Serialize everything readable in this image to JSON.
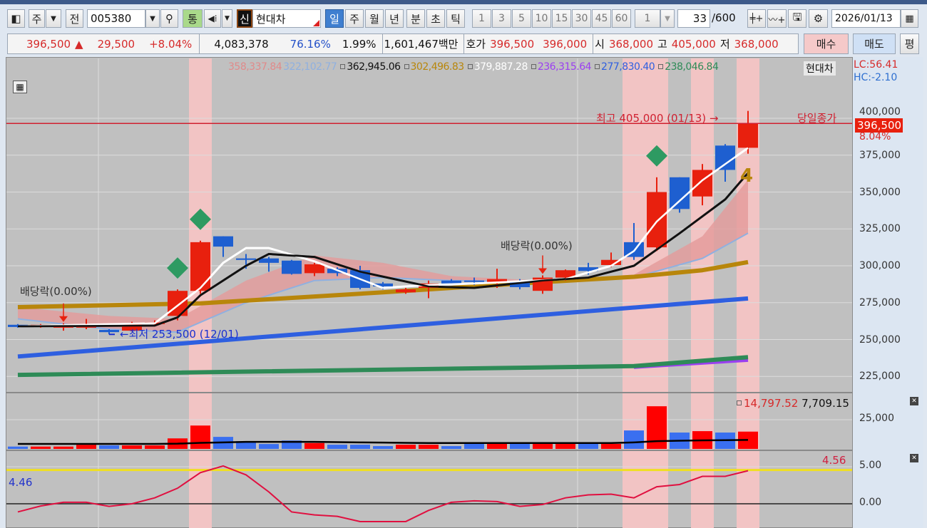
{
  "toolbar": {
    "market": "주",
    "all_label": "전",
    "code": "005380",
    "comm_label": "통",
    "new_label": "신",
    "stock_name": "현대차",
    "periods": [
      "일",
      "주",
      "월",
      "년",
      "분",
      "초",
      "틱"
    ],
    "selected_period": "일",
    "intervals": [
      "1",
      "3",
      "5",
      "10",
      "15",
      "30",
      "45",
      "60"
    ],
    "multiplier": "1",
    "count": "33",
    "count_total": "/600",
    "date": "2026/01/13"
  },
  "quote": {
    "price": "396,500",
    "arrow": "▲",
    "change": "29,500",
    "change_pct": "+8.04%",
    "volume": "4,083,378",
    "vol_ratio": "76.16%",
    "turnover": "1.99%",
    "amount": "1,601,467백만",
    "bid_label": "호가",
    "ask": "396,500",
    "bid": "396,000",
    "open_label": "시",
    "open": "368,000",
    "high_label": "고",
    "high": "405,000",
    "low_label": "저",
    "low": "368,000",
    "buy_label": "매수",
    "sell_label": "매도",
    "avg_label": "평"
  },
  "legend": [
    {
      "text": "358,337.84",
      "color": "#e08a8a",
      "box": false
    },
    {
      "text": "322,102.77",
      "color": "#8fb0e0",
      "box": false
    },
    {
      "text": "362,945.06",
      "color": "#111111",
      "box": true
    },
    {
      "text": "302,496.83",
      "color": "#b8860b",
      "box": true
    },
    {
      "text": "379,887.28",
      "color": "#ffffff",
      "box": true
    },
    {
      "text": "236,315.64",
      "color": "#9a3ff0",
      "box": true
    },
    {
      "text": "277,830.40",
      "color": "#2e5fe0",
      "box": true
    },
    {
      "text": "238,046.84",
      "color": "#2e8b57",
      "box": true
    }
  ],
  "legend_name": "현대차",
  "axis": {
    "lc": "LC:56.41",
    "hc": "HC:-2.10",
    "price_ticks": [
      "400,000",
      "375,000",
      "350,000",
      "325,000",
      "300,000",
      "275,000",
      "250,000",
      "225,000"
    ],
    "current_price": "396,500",
    "current_pct": "8.04%",
    "volume_tick": "25,000",
    "indicator_ticks": [
      "5.00",
      "0.00"
    ]
  },
  "annotations": {
    "dividend1": "배당락(0.00%)",
    "dividend2": "배당락(0.00%)",
    "high": "최고 405,000 (01/13) →",
    "low": "←최저 253,500 (12/01)",
    "close_label": "당일종가",
    "signal_glyph": "4"
  },
  "volume_legend": {
    "value": "14,797.52",
    "ma": "7,709.15"
  },
  "indicator_legend": {
    "left": "4.46",
    "right": "4.56"
  },
  "colors": {
    "up": "#e8200e",
    "down": "#1e5fd0",
    "highlight": "#f2c4c4",
    "signal": "#2e9a62"
  },
  "chart_data": {
    "type": "candlestick",
    "price_range": [
      215000,
      425000
    ],
    "candles_ohlc": [
      [
        260000,
        260500,
        258000,
        258500
      ],
      [
        258500,
        260500,
        258000,
        260000
      ],
      [
        258500,
        261000,
        256000,
        259000
      ],
      [
        258500,
        264000,
        257000,
        259000
      ],
      [
        256500,
        257000,
        253500,
        255000
      ],
      [
        256000,
        262000,
        255500,
        261000
      ],
      [
        260500,
        263000,
        259000,
        261500
      ],
      [
        266000,
        284000,
        263000,
        283000
      ],
      [
        283000,
        317000,
        281000,
        316000
      ],
      [
        320000,
        320000,
        306000,
        313000
      ],
      [
        305000,
        308000,
        298000,
        304000
      ],
      [
        305000,
        306000,
        296000,
        302000
      ],
      [
        303500,
        304000,
        294000,
        294500
      ],
      [
        295000,
        302000,
        293000,
        301000
      ],
      [
        298000,
        299000,
        293000,
        295000
      ],
      [
        297000,
        300000,
        284000,
        285000
      ],
      [
        288000,
        289000,
        284000,
        286000
      ],
      [
        282000,
        285000,
        281000,
        284000
      ],
      [
        285000,
        290000,
        278000,
        288000
      ],
      [
        290000,
        291000,
        287000,
        288000
      ],
      [
        290000,
        292000,
        287000,
        289500
      ],
      [
        289000,
        298000,
        285000,
        291000
      ],
      [
        289000,
        291000,
        284000,
        285500
      ],
      [
        283000,
        293500,
        281000,
        292000
      ],
      [
        292000,
        297500,
        290000,
        297000
      ],
      [
        299000,
        302000,
        294000,
        296500
      ],
      [
        300500,
        309000,
        299000,
        304000
      ],
      [
        316000,
        329000,
        304000,
        306000
      ],
      [
        312500,
        360000,
        310000,
        350000
      ],
      [
        360000,
        360000,
        336000,
        338500
      ],
      [
        347000,
        369000,
        341000,
        365000
      ],
      [
        381500,
        382500,
        357000,
        365000
      ],
      [
        380000,
        405000,
        376000,
        396500
      ]
    ],
    "highlighted_candles": [
      8,
      27,
      28,
      30,
      32
    ],
    "signal_diamonds": [
      7,
      8,
      28
    ],
    "dividend_markers": [
      2,
      23
    ],
    "ma_lines": [
      {
        "color": "#ffffff",
        "points": [
          [
            0,
            259000
          ],
          [
            6,
            261000
          ],
          [
            8,
            285000
          ],
          [
            9,
            302000
          ],
          [
            10,
            312000
          ],
          [
            11,
            312000
          ],
          [
            13,
            303000
          ],
          [
            16,
            285000
          ],
          [
            18,
            287000
          ],
          [
            20,
            288000
          ],
          [
            24,
            291000
          ],
          [
            26,
            300000
          ],
          [
            27,
            310000
          ],
          [
            28,
            330000
          ],
          [
            30,
            358000
          ],
          [
            32,
            379887
          ]
        ]
      },
      {
        "color": "#111111",
        "points": [
          [
            0,
            259000
          ],
          [
            6,
            259500
          ],
          [
            7,
            265000
          ],
          [
            8,
            280000
          ],
          [
            10,
            300000
          ],
          [
            11,
            308000
          ],
          [
            13,
            306000
          ],
          [
            15,
            296000
          ],
          [
            18,
            286000
          ],
          [
            20,
            285000
          ],
          [
            23,
            290000
          ],
          [
            25,
            292000
          ],
          [
            27,
            300000
          ],
          [
            29,
            322000
          ],
          [
            31,
            345000
          ],
          [
            32,
            362945
          ]
        ]
      },
      {
        "color": "#b8860b",
        "points": [
          [
            0,
            272000
          ],
          [
            8,
            274500
          ],
          [
            16,
            282000
          ],
          [
            22,
            288000
          ],
          [
            27,
            292500
          ],
          [
            30,
            297000
          ],
          [
            32,
            302497
          ]
        ]
      },
      {
        "color": "#2e5fe0",
        "points": [
          [
            0,
            238500
          ],
          [
            32,
            277830
          ]
        ]
      },
      {
        "color": "#2e8b57",
        "points": [
          [
            0,
            226000
          ],
          [
            27,
            232000
          ],
          [
            32,
            238047
          ]
        ]
      },
      {
        "color": "#9a3ff0",
        "points": [
          [
            27,
            231500
          ],
          [
            32,
            236316
          ]
        ]
      }
    ],
    "cloud_upper": [
      [
        0,
        272000
      ],
      [
        4,
        266000
      ],
      [
        7,
        264000
      ],
      [
        10,
        290000
      ],
      [
        13,
        307000
      ],
      [
        16,
        302000
      ],
      [
        19,
        293000
      ],
      [
        23,
        290000
      ],
      [
        27,
        294000
      ],
      [
        30,
        320000
      ],
      [
        32,
        358338
      ]
    ],
    "cloud_lower": [
      [
        0,
        264000
      ],
      [
        4,
        257000
      ],
      [
        7,
        255000
      ],
      [
        10,
        275000
      ],
      [
        13,
        290000
      ],
      [
        16,
        292000
      ],
      [
        19,
        290000
      ],
      [
        23,
        289000
      ],
      [
        27,
        292000
      ],
      [
        30,
        305000
      ],
      [
        32,
        322103
      ]
    ],
    "volume": [
      2000,
      2000,
      2000,
      3500,
      3000,
      3000,
      3000,
      9000,
      20000,
      10300,
      6600,
      4200,
      7200,
      5000,
      3600,
      3600,
      2400,
      3600,
      3600,
      2400,
      4300,
      4300,
      4300,
      4300,
      4300,
      4300,
      4300,
      15800,
      36500,
      14000,
      15200,
      14000,
      14797
    ],
    "volume_ma": [
      4300,
      4300,
      4300,
      4300,
      4300,
      4300,
      4300,
      4500,
      5200,
      5600,
      6000,
      6000,
      6000,
      6000,
      5800,
      5600,
      5400,
      5200,
      5000,
      5000,
      5000,
      5000,
      5000,
      5000,
      5000,
      5000,
      5000,
      5600,
      6600,
      7000,
      7300,
      7500,
      7709
    ],
    "volume_range": [
      0,
      50000
    ],
    "indicator": [
      -1.1,
      -0.3,
      0.2,
      0.2,
      -0.35,
      0,
      0.8,
      2.1,
      4.2,
      5.1,
      3.9,
      1.6,
      -1.1,
      -1.5,
      -1.7,
      -2.4,
      -2.4,
      -2.4,
      -0.9,
      0.2,
      0.4,
      0.3,
      -0.35,
      -0.1,
      0.8,
      1.2,
      1.3,
      0.8,
      2.3,
      2.6,
      3.7,
      3.7,
      4.46
    ],
    "indicator_signal_level": 4.56
  }
}
